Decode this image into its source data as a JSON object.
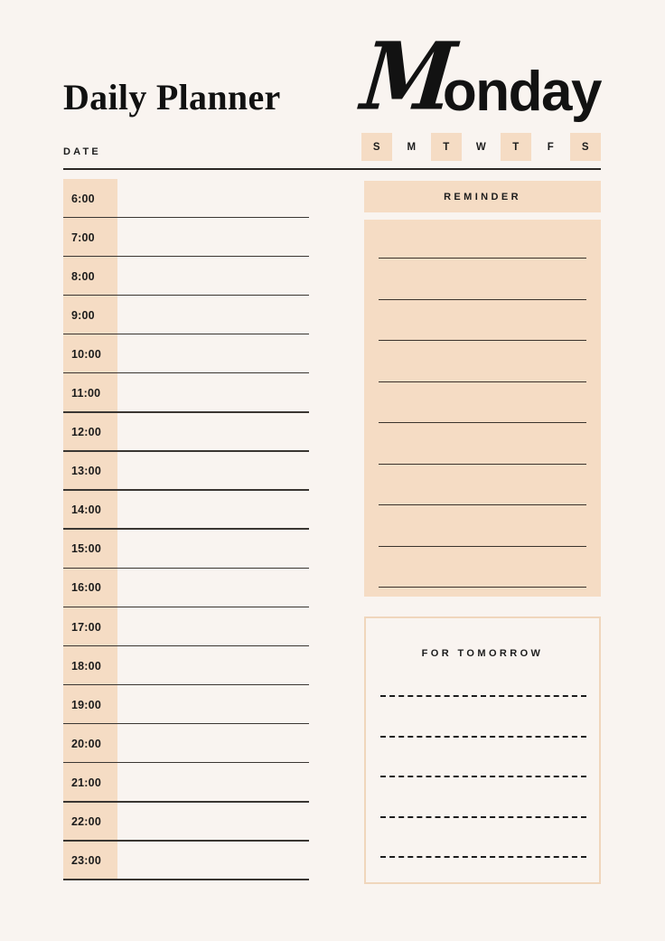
{
  "page": {
    "background_color": "#F9F4F0",
    "accent_color": "#F5DCC4",
    "border_color": "#F0D6BC",
    "ink_color": "#1c1c1c"
  },
  "header": {
    "title": "Daily Planner",
    "day_name_initial": "M",
    "day_name_rest": "onday",
    "day_name_full": "Monday",
    "date_label": "DATE",
    "date_value": ""
  },
  "weekdays": [
    {
      "label": "S",
      "name": "sunday",
      "selected": true
    },
    {
      "label": "M",
      "name": "monday",
      "selected": false
    },
    {
      "label": "T",
      "name": "tuesday",
      "selected": true
    },
    {
      "label": "W",
      "name": "wednesday",
      "selected": false
    },
    {
      "label": "T",
      "name": "thursday",
      "selected": true
    },
    {
      "label": "F",
      "name": "friday",
      "selected": false
    },
    {
      "label": "S",
      "name": "saturday",
      "selected": true
    }
  ],
  "schedule": {
    "slots": [
      {
        "time": "6:00",
        "entry": ""
      },
      {
        "time": "7:00",
        "entry": ""
      },
      {
        "time": "8:00",
        "entry": ""
      },
      {
        "time": "9:00",
        "entry": ""
      },
      {
        "time": "10:00",
        "entry": ""
      },
      {
        "time": "11:00",
        "entry": ""
      },
      {
        "time": "12:00",
        "entry": ""
      },
      {
        "time": "13:00",
        "entry": ""
      },
      {
        "time": "14:00",
        "entry": ""
      },
      {
        "time": "15:00",
        "entry": ""
      },
      {
        "time": "16:00",
        "entry": ""
      },
      {
        "time": "17:00",
        "entry": ""
      },
      {
        "time": "18:00",
        "entry": ""
      },
      {
        "time": "19:00",
        "entry": ""
      },
      {
        "time": "20:00",
        "entry": ""
      },
      {
        "time": "21:00",
        "entry": ""
      },
      {
        "time": "22:00",
        "entry": ""
      },
      {
        "time": "23:00",
        "entry": ""
      }
    ]
  },
  "reminder": {
    "title": "REMINDER",
    "line_count": 9,
    "entries": [
      "",
      "",
      "",
      "",
      "",
      "",
      "",
      "",
      ""
    ]
  },
  "tomorrow": {
    "title": "FOR TOMORROW",
    "line_count": 5,
    "entries": [
      "",
      "",
      "",
      "",
      ""
    ]
  }
}
